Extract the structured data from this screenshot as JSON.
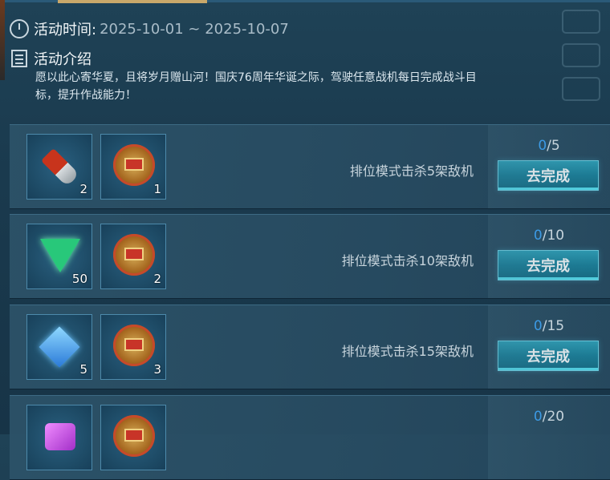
{
  "activity": {
    "time_label": "活动时间:",
    "time_value": "2025-10-01 ~ 2025-10-07",
    "intro_title": "活动介绍",
    "intro_text": "愿以此心寄华夏，且将岁月赠山河！国庆76周年华诞之际，驾驶任意战机每日完成战斗目标，提升作战能力！"
  },
  "tasks": [
    {
      "rewards": [
        {
          "icon": "missile-shell-icon",
          "count": "2"
        },
        {
          "icon": "medal-icon",
          "count": "1"
        }
      ],
      "description": "排位模式击杀5架敌机",
      "progress_current": "0",
      "progress_total": "/5",
      "button": "去完成"
    },
    {
      "rewards": [
        {
          "icon": "green-gem-icon",
          "count": "50"
        },
        {
          "icon": "medal-icon",
          "count": "2"
        }
      ],
      "description": "排位模式击杀10架敌机",
      "progress_current": "0",
      "progress_total": "/10",
      "button": "去完成"
    },
    {
      "rewards": [
        {
          "icon": "blue-crystal-icon",
          "count": "5"
        },
        {
          "icon": "medal-icon",
          "count": "3"
        }
      ],
      "description": "排位模式击杀15架敌机",
      "progress_current": "0",
      "progress_total": "/15",
      "button": "去完成"
    },
    {
      "rewards": [
        {
          "icon": "purple-gem-icon",
          "count": ""
        },
        {
          "icon": "medal-icon",
          "count": ""
        }
      ],
      "description": "",
      "progress_current": "0",
      "progress_total": "/20",
      "button": ""
    }
  ]
}
